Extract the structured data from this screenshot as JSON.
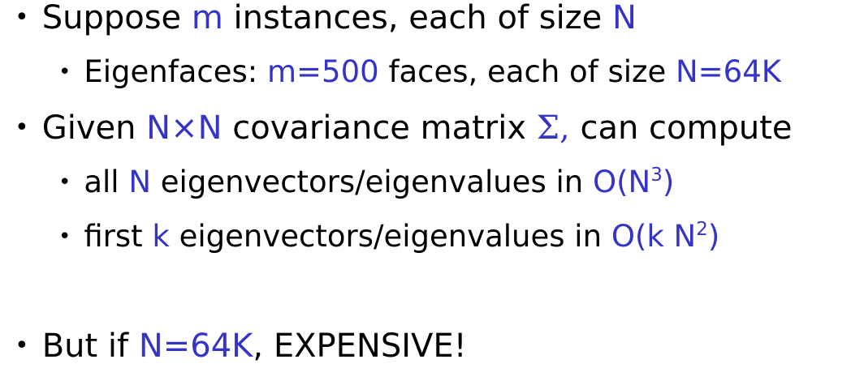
{
  "colors": {
    "text": "#000000",
    "highlight": "#3434c8",
    "background": "#ffffff"
  },
  "bullet_glyph": "•",
  "lines": [
    {
      "level": 1,
      "segments": [
        {
          "t": "Suppose "
        },
        {
          "t": "m",
          "hl": true
        },
        {
          "t": " instances, each of size "
        },
        {
          "t": "N",
          "hl": true
        }
      ]
    },
    {
      "level": 2,
      "segments": [
        {
          "t": "Eigenfaces: "
        },
        {
          "t": "m=500",
          "hl": true
        },
        {
          "t": " faces, each of size "
        },
        {
          "t": "N=64K",
          "hl": true
        }
      ]
    },
    {
      "level": 1,
      "segments": [
        {
          "t": "Given "
        },
        {
          "t": "N×N",
          "hl": true
        },
        {
          "t": " covariance matrix "
        },
        {
          "t": "Σ,",
          "hl": true,
          "sigma": true
        },
        {
          "t": " can compute"
        }
      ]
    },
    {
      "level": 2,
      "segments": [
        {
          "t": "all "
        },
        {
          "t": "N",
          "hl": true
        },
        {
          "t": " eigenvectors/eigenvalues in "
        },
        {
          "t": "O(N",
          "hl": true
        },
        {
          "t": "3",
          "hl": true,
          "sup": true
        },
        {
          "t": ")",
          "hl": true
        }
      ]
    },
    {
      "level": 2,
      "segments": [
        {
          "t": "first "
        },
        {
          "t": "k",
          "hl": true
        },
        {
          "t": " eigenvectors/eigenvalues in "
        },
        {
          "t": "O(k N",
          "hl": true
        },
        {
          "t": "2",
          "hl": true,
          "sup": true
        },
        {
          "t": ")",
          "hl": true
        }
      ]
    },
    {
      "level": 1,
      "segments": [
        {
          "t": "But if "
        },
        {
          "t": "N=64K",
          "hl": true
        },
        {
          "t": ", EXPENSIVE!"
        }
      ]
    }
  ]
}
